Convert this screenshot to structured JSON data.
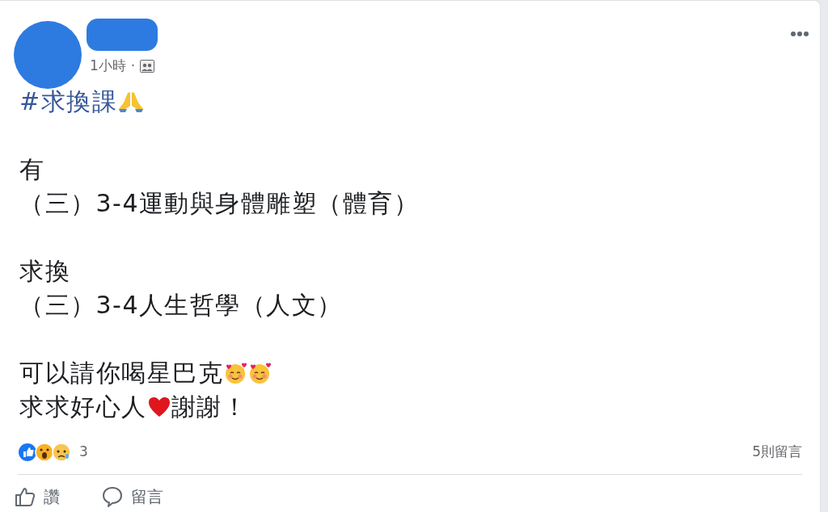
{
  "post": {
    "time": "1小時",
    "separator": "·",
    "hashtag": "#求換課",
    "paragraphs": [
      {
        "lines": [
          [
            {
              "kind": "text",
              "text": "有"
            }
          ],
          [
            {
              "kind": "text",
              "text": "（三）3-4運動與身體雕塑（體育）"
            }
          ]
        ]
      },
      {
        "lines": [
          [
            {
              "kind": "text",
              "text": "求換"
            }
          ],
          [
            {
              "kind": "text",
              "text": "（三）3-4人生哲學（人文）"
            }
          ]
        ]
      },
      {
        "lines": [
          [
            {
              "kind": "text",
              "text": "可以請你喝星巴克"
            },
            {
              "kind": "smile"
            },
            {
              "kind": "smile"
            }
          ],
          [
            {
              "kind": "text",
              "text": "求求好心人"
            },
            {
              "kind": "heart"
            },
            {
              "kind": "text",
              "text": "謝謝！"
            }
          ]
        ]
      }
    ]
  },
  "reactions": {
    "count": "3",
    "comments": "5則留言"
  },
  "actions": [
    {
      "kind": "like",
      "label": "讚"
    },
    {
      "kind": "comment",
      "label": "留言"
    }
  ]
}
